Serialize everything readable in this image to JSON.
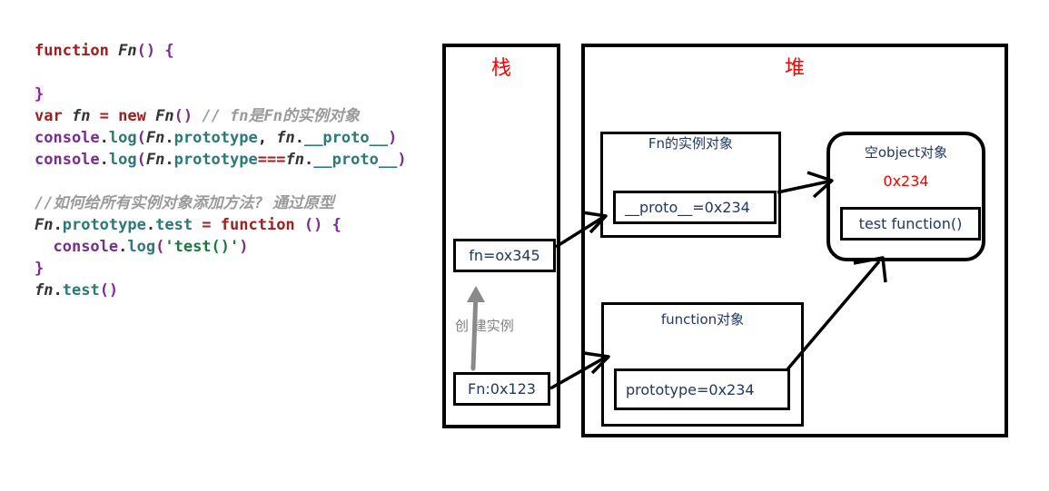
{
  "code": {
    "lines": [
      [
        {
          "t": "function ",
          "c": "kw"
        },
        {
          "t": "Fn",
          "c": "fname"
        },
        {
          "t": "() {",
          "c": "punc"
        }
      ],
      [],
      [
        {
          "t": "}",
          "c": "punc hl"
        }
      ],
      [
        {
          "t": "var ",
          "c": "kw"
        },
        {
          "t": "fn",
          "c": "fname"
        },
        {
          "t": " = ",
          "c": "eq"
        },
        {
          "t": "new ",
          "c": "kw"
        },
        {
          "t": "Fn",
          "c": "fname"
        },
        {
          "t": "()",
          "c": "punc"
        },
        {
          "t": " ",
          "c": "plain"
        },
        {
          "t": "// fn是Fn的实例对象",
          "c": "cmt"
        }
      ],
      [
        {
          "t": "console",
          "c": "obj"
        },
        {
          "t": ".",
          "c": "dot"
        },
        {
          "t": "log",
          "c": "prop"
        },
        {
          "t": "(",
          "c": "punc"
        },
        {
          "t": "Fn",
          "c": "fname"
        },
        {
          "t": ".",
          "c": "dot"
        },
        {
          "t": "prototype",
          "c": "prop"
        },
        {
          "t": ", ",
          "c": "plain"
        },
        {
          "t": "fn",
          "c": "fname"
        },
        {
          "t": ".",
          "c": "dot"
        },
        {
          "t": "__proto__",
          "c": "prop"
        },
        {
          "t": ")",
          "c": "punc"
        }
      ],
      [
        {
          "t": "console",
          "c": "obj"
        },
        {
          "t": ".",
          "c": "dot"
        },
        {
          "t": "log",
          "c": "prop"
        },
        {
          "t": "(",
          "c": "punc"
        },
        {
          "t": "Fn",
          "c": "fname"
        },
        {
          "t": ".",
          "c": "dot"
        },
        {
          "t": "prototype",
          "c": "prop"
        },
        {
          "t": "===",
          "c": "eq"
        },
        {
          "t": "fn",
          "c": "fname"
        },
        {
          "t": ".",
          "c": "dot"
        },
        {
          "t": "__proto__",
          "c": "prop"
        },
        {
          "t": ")",
          "c": "punc"
        }
      ],
      [],
      [
        {
          "t": "//如何给所有实例对象添加方法? 通过原型",
          "c": "cmt"
        }
      ],
      [
        {
          "t": "Fn",
          "c": "fname"
        },
        {
          "t": ".",
          "c": "dot"
        },
        {
          "t": "prototype",
          "c": "prop"
        },
        {
          "t": ".",
          "c": "dot"
        },
        {
          "t": "test",
          "c": "prop"
        },
        {
          "t": " = ",
          "c": "eq"
        },
        {
          "t": "function",
          "c": "kw"
        },
        {
          "t": " () {",
          "c": "punc"
        }
      ],
      [
        {
          "t": "  ",
          "c": "plain"
        },
        {
          "t": "console",
          "c": "obj"
        },
        {
          "t": ".",
          "c": "dot"
        },
        {
          "t": "log",
          "c": "prop"
        },
        {
          "t": "(",
          "c": "punc"
        },
        {
          "t": "'test()'",
          "c": "str"
        },
        {
          "t": ")",
          "c": "punc"
        }
      ],
      [
        {
          "t": "}",
          "c": "punc"
        }
      ],
      [
        {
          "t": "fn",
          "c": "fname"
        },
        {
          "t": ".",
          "c": "dot"
        },
        {
          "t": "test",
          "c": "prop"
        },
        {
          "t": "()",
          "c": "punc"
        }
      ]
    ]
  },
  "diagram": {
    "stack": {
      "title": "栈",
      "title_color": "#ff0000",
      "slots": [
        {
          "name": "fn-slot",
          "label": "fn=ox345"
        },
        {
          "name": "fn-constructor-slot",
          "label": "Fn:0x123"
        }
      ],
      "arrow_label": "创 建实例",
      "arrow_label_color": "#808080"
    },
    "heap": {
      "title": "堆",
      "title_color": "#ff0000",
      "instance_object": {
        "title": "Fn的实例对象",
        "slot": "__proto__=0x234"
      },
      "empty_object": {
        "title": "空object对象",
        "address": "0x234",
        "address_color": "#ff0000",
        "slot": "test function()"
      },
      "function_object": {
        "title": "function对象",
        "slot": "prototype=0x234"
      }
    }
  }
}
